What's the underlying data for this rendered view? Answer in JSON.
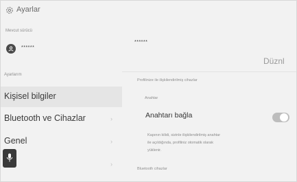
{
  "header": {
    "title": "Ayarlar",
    "icon": "gear-icon"
  },
  "left": {
    "current_driver_label": "Mevcut sürücü",
    "driver_name": "******",
    "settings_label": "Ayarlarım",
    "menu": [
      {
        "label": "Kişisel bilgiler",
        "active": true
      },
      {
        "label": "Bluetooth ve Cihazlar"
      },
      {
        "label": "Genel"
      },
      {
        "label": ""
      }
    ]
  },
  "right": {
    "password": "******",
    "edit_label": "Düznl",
    "linked_devices_label": "Profilinize ile ilişkilendirilmiş cihazlar",
    "key_section_label": "Anahtar",
    "connect_key_label": "Anahtarı bağla",
    "toggle_on": false,
    "description_lines": [
      "Kapının kilidi, sizinle ilişkilendirilmiş anahtar",
      "ile açıldığında, profiliniz otomatik olarak",
      "yüklenir."
    ],
    "bluetooth_devices_label": "Bluetooth cihazlar"
  },
  "mic_icon": "microphone-icon",
  "colors": {
    "background": "#f2f2f2",
    "active_row": "#e5e5e5",
    "toggle_off": "#bdbdbd",
    "fab": "#3a3a3a"
  }
}
